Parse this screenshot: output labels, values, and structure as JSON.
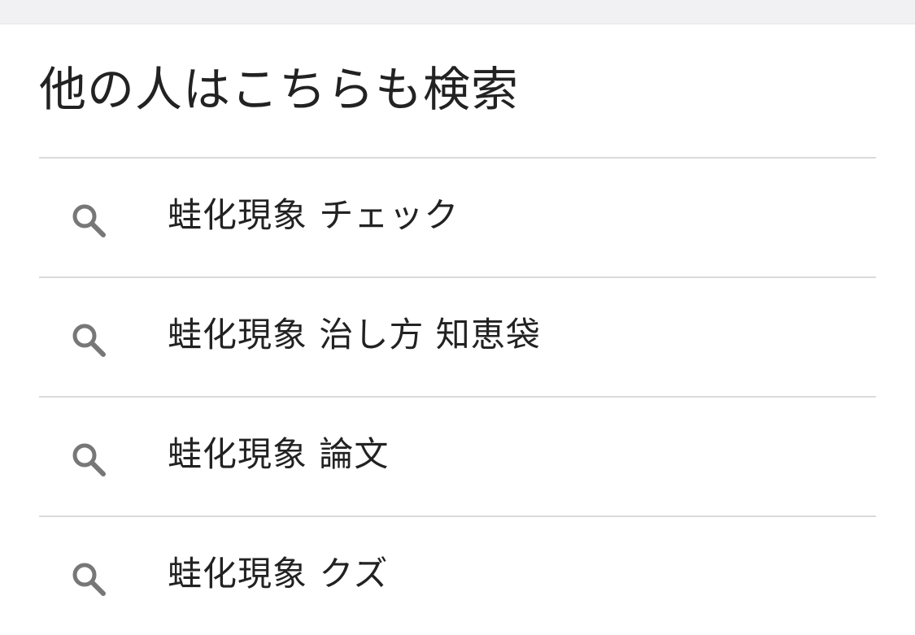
{
  "section": {
    "title": "他の人はこちらも検索"
  },
  "related_searches": [
    {
      "label": "蛙化現象 チェック",
      "icon": "search-icon"
    },
    {
      "label": "蛙化現象 治し方 知恵袋",
      "icon": "search-icon"
    },
    {
      "label": "蛙化現象 論文",
      "icon": "search-icon"
    },
    {
      "label": "蛙化現象 クズ",
      "icon": "search-icon"
    }
  ],
  "colors": {
    "divider": "#dadada",
    "icon": "#777777",
    "text": "#222222",
    "topbar": "#f1f1f3"
  }
}
